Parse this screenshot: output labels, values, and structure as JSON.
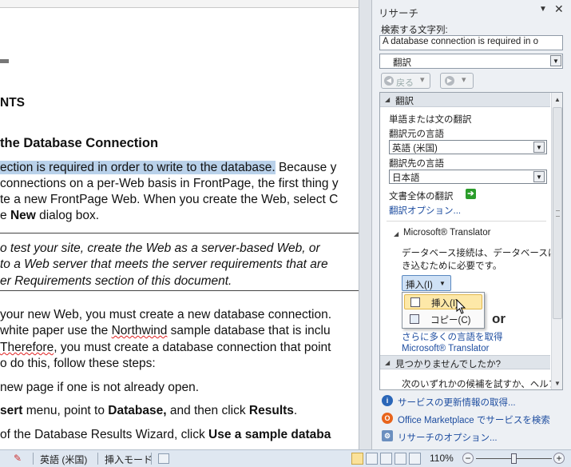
{
  "document": {
    "heading1": "NTS",
    "heading2": " the Database Connection",
    "p1_line1_hl": "ection is required in order to write to the database.",
    "p1_line1_rest": " Because y",
    "p1_line2": "connections on a per-Web basis in FrontPage, the first thing y",
    "p1_line3": "te a new FrontPage Web. When you create the Web, select C",
    "p1_line4_pre": "e ",
    "p1_line4_bold": "New",
    "p1_line4_post": " dialog box.",
    "note_line1": "o test your site, create the Web as a server-based Web, or",
    "note_line2": "to a Web server that meets the server requirements that are",
    "note_line3": "er Requirements section of this document.",
    "p2_line1": " your new Web, you must create a  new database connection.",
    "p2_line2_pre": "white paper use the ",
    "p2_line2_link": "Northwind",
    "p2_line2_post": " sample database that is inclu",
    "p2_line3_pre": "Therefore",
    "p2_line3_post": ", you must create a database connection that point",
    "p2_line4": "o do this, follow these steps:",
    "step1": "new page if one is not already open.",
    "step2_a": "sert",
    "step2_b": " menu, point to ",
    "step2_c": "Database,",
    "step2_d": " and then click ",
    "step2_e": "Results",
    "step2_f": ".",
    "step3_a": "of the Database Results Wizard, click ",
    "step3_b": "Use a sample databa"
  },
  "pane": {
    "title": "リサーチ",
    "search_label": "検索する文字列:",
    "search_value": "A database connection is required in o",
    "service": "翻訳",
    "back_label": "戻る",
    "section_title": "翻訳",
    "word_label": "単語または文の翻訳",
    "from_label": "翻訳元の言語",
    "from_value": "英語 (米国)",
    "to_label": "翻訳先の言語",
    "to_value": "日本語",
    "full_doc": "文書全体の翻訳",
    "options_link": "翻訳オプション...",
    "ms_translator_head": "Microsoft® Translator",
    "translation_line1": "データベース接続は、データベースに書",
    "translation_line2": "き込むために必要です。",
    "insert_button": "挿入(I)",
    "menu_insert": "挿入(I)",
    "menu_copy": "コピー(C)",
    "logo_partial": "or",
    "more_languages": "さらに多くの言語を取得",
    "ms_translator_link": "Microsoft® Translator",
    "notfound_head": "見つかりませんでしたか?",
    "notfound_text": "次のいずれかの候補を試すか、ヘルプにあ",
    "footer_update": "サービスの更新情報の取得...",
    "footer_marketplace": "Office Marketplace でサービスを検索",
    "footer_options": "リサーチのオプション..."
  },
  "status": {
    "language": "英語 (米国)",
    "mode": "挿入モード",
    "zoom": "110%"
  },
  "colors": {
    "selection": "#b9d1ea",
    "link": "#1f4ea0",
    "accent_green": "#2b9d2b"
  }
}
